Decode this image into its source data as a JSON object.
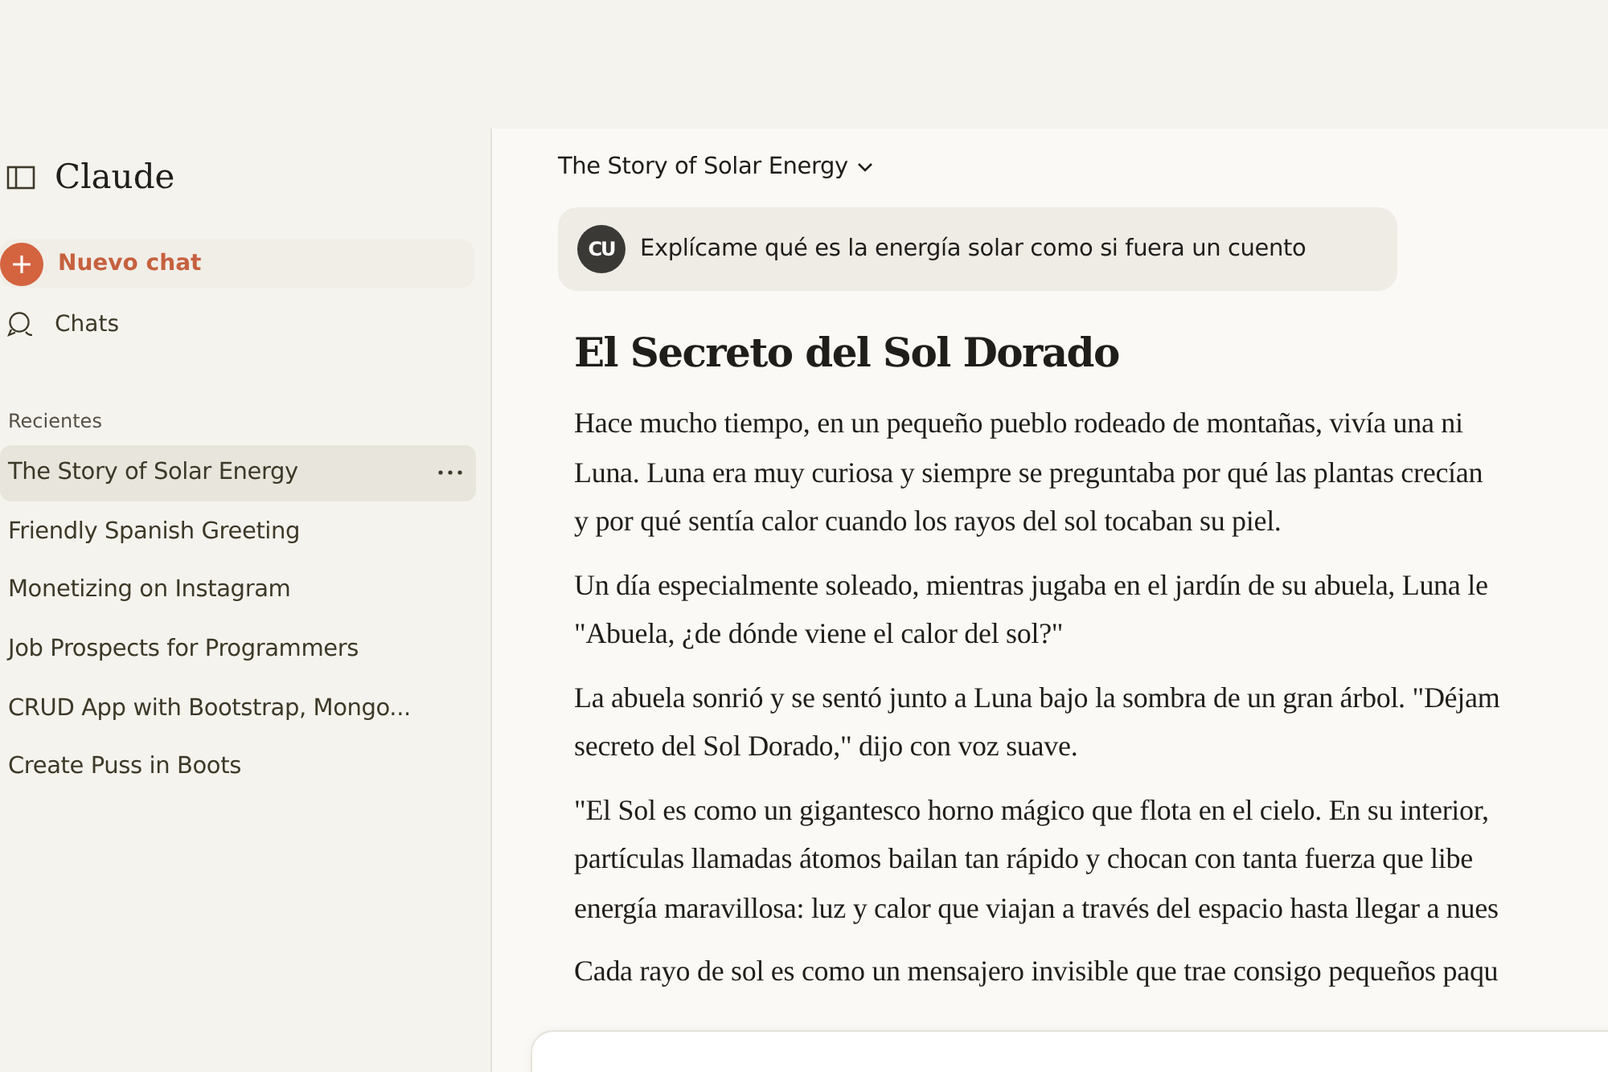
{
  "sidebar": {
    "title": "Claude",
    "new_chat": "Nuevo chat",
    "chats": "Chats",
    "section": "Recientes",
    "items": [
      {
        "label": "The Story of Solar Energy",
        "selected": true
      },
      {
        "label": "Friendly Spanish Greeting",
        "selected": false
      },
      {
        "label": "Monetizing on Instagram",
        "selected": false
      },
      {
        "label": "Job Prospects for Programmers",
        "selected": false
      },
      {
        "label": "CRUD App with Bootstrap, Mongo...",
        "selected": false
      },
      {
        "label": "Create Puss in Boots",
        "selected": false
      }
    ]
  },
  "conversation": {
    "title": "The Story of Solar Energy",
    "user_initials": "CU",
    "user_message": "Explícame qué es la energía solar como si fuera un cuento",
    "heading": "El Secreto del Sol Dorado",
    "paragraphs": [
      {
        "lines": [
          "Hace mucho tiempo, en un pequeño pueblo rodeado de montañas, vivía una ni",
          "Luna. Luna era muy curiosa y siempre se preguntaba por qué las plantas crecían",
          "y por qué sentía calor cuando los rayos del sol tocaban su piel."
        ]
      },
      {
        "lines": [
          "Un día especialmente soleado, mientras jugaba en el jardín de su abuela, Luna le",
          "\"Abuela, ¿de dónde viene el calor del sol?\""
        ]
      },
      {
        "lines": [
          "La abuela sonrió y se sentó junto a Luna bajo la sombra de un gran árbol. \"Déjam",
          "secreto del Sol Dorado,\" dijo con voz suave."
        ]
      },
      {
        "lines": [
          "\"El Sol es como un gigantesco horno mágico que flota en el cielo. En su interior,",
          "partículas llamadas átomos bailan tan rápido y chocan con tanta fuerza que libe",
          "energía maravillosa: luz y calor que viajan a través del espacio hasta llegar a nues"
        ]
      },
      {
        "lines": [
          "Cada rayo de sol es como un mensajero invisible que trae consigo pequeños paqu"
        ]
      }
    ]
  }
}
